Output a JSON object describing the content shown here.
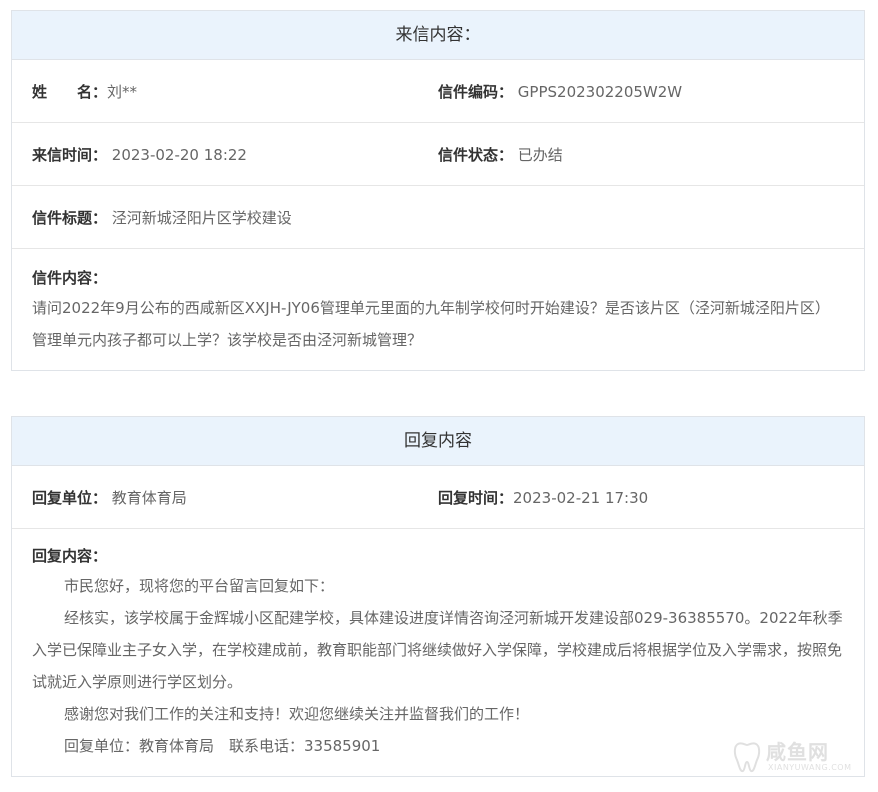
{
  "letter": {
    "header": "来信内容：",
    "name_label": "姓　　名：",
    "name_value": "刘**",
    "code_label": "信件编码：",
    "code_value": "GPPS202302205W2W",
    "time_label": "来信时间：",
    "time_value": "2023-02-20 18:22",
    "status_label": "信件状态：",
    "status_value": "已办结",
    "title_label": "信件标题：",
    "title_value": "泾河新城泾阳片区学校建设",
    "content_label": "信件内容：",
    "content_value": "请问2022年9月公布的西咸新区XXJH-JY06管理单元里面的九年制学校何时开始建设？是否该片区（泾河新城泾阳片区）管理单元内孩子都可以上学？该学校是否由泾河新城管理？"
  },
  "reply": {
    "header": "回复内容",
    "unit_label": "回复单位：",
    "unit_value": "教育体育局",
    "time_label": "回复时间：",
    "time_value": "2023-02-21 17:30",
    "content_label": "回复内容：",
    "paragraphs": [
      "市民您好，现将您的平台留言回复如下：",
      "经核实，该学校属于金辉城小区配建学校，具体建设进度详情咨询泾河新城开发建设部029-36385570。2022年秋季入学已保障业主子女入学，在学校建成前，教育职能部门将继续做好入学保障，学校建成后将根据学位及入学需求，按照免试就近入学原则进行学区划分。",
      "感谢您对我们工作的关注和支持！欢迎您继续关注并监督我们的工作！",
      "回复单位：教育体育局　联系电话：33585901"
    ]
  },
  "watermark": {
    "text": "咸鱼网",
    "sub": "XIANYUWANG.COM"
  }
}
